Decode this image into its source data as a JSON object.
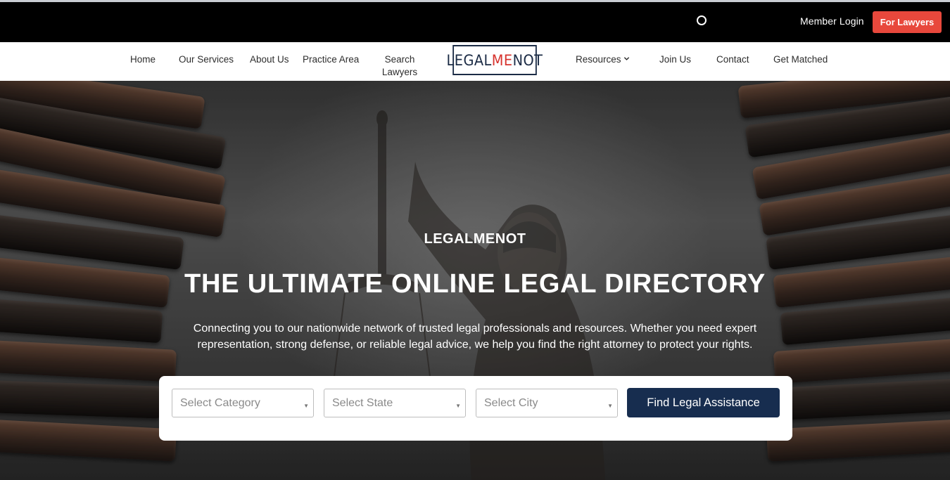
{
  "topbar": {
    "member_login": "Member Login",
    "for_lawyers": "For Lawyers"
  },
  "nav": {
    "home": "Home",
    "our_services": "Our Services",
    "about_us": "About Us",
    "practice_area": "Practice Area",
    "search_lawyers_line1": "Search",
    "search_lawyers_line2": "Lawyers",
    "resources": "Resources",
    "join_us": "Join Us",
    "contact": "Contact",
    "get_matched": "Get Matched"
  },
  "logo": {
    "part1": "LEGAL",
    "part2": "ME",
    "part3": "NOT"
  },
  "hero": {
    "eyebrow": "LEGALMENOT",
    "headline": "THE ULTIMATE ONLINE LEGAL DIRECTORY",
    "subtext": "Connecting you to our nationwide network of trusted legal professionals and resources. Whether you need expert representation, strong defense, or reliable legal advice, we help you find the right attorney to protect your rights."
  },
  "search": {
    "category_placeholder": "Select Category",
    "state_placeholder": "Select State",
    "city_placeholder": "Select City",
    "find_button": "Find Legal Assistance"
  },
  "icons": {
    "loading": "spinner-icon",
    "dropdown": "chevron-down-icon",
    "select_caret": "caret-down-icon"
  },
  "colors": {
    "topbar_bg": "#000000",
    "accent_red": "#e8483c",
    "navy": "#172d4f",
    "logo_navy": "#1b2b45"
  }
}
